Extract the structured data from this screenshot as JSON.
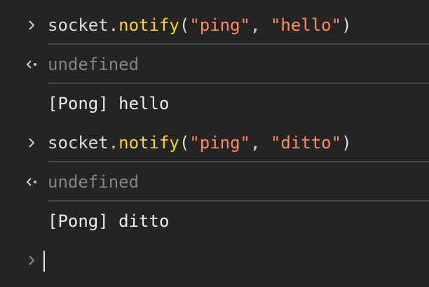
{
  "console": {
    "entries": [
      {
        "kind": "input",
        "icon": "chevron-right-icon",
        "object": "socket",
        "dot": ".",
        "method": "notify",
        "open": "(",
        "arg1": "\"ping\"",
        "comma": ", ",
        "arg2": "\"hello\"",
        "close": ")"
      },
      {
        "kind": "result",
        "icon": "return-arrow-icon",
        "text": "undefined"
      },
      {
        "kind": "log",
        "text": "[Pong] hello"
      },
      {
        "kind": "input",
        "icon": "chevron-right-icon",
        "object": "socket",
        "dot": ".",
        "method": "notify",
        "open": "(",
        "arg1": "\"ping\"",
        "comma": ", ",
        "arg2": "\"ditto\"",
        "close": ")"
      },
      {
        "kind": "result",
        "icon": "return-arrow-icon",
        "text": "undefined"
      },
      {
        "kind": "log",
        "text": "[Pong] ditto"
      }
    ],
    "prompt": {
      "icon": "chevron-right-icon",
      "value": ""
    }
  },
  "colors": {
    "background": "#242424",
    "method": "#ffd21f",
    "string": "#ff8a5c",
    "muted": "#858585",
    "text": "#e6e6e6"
  }
}
